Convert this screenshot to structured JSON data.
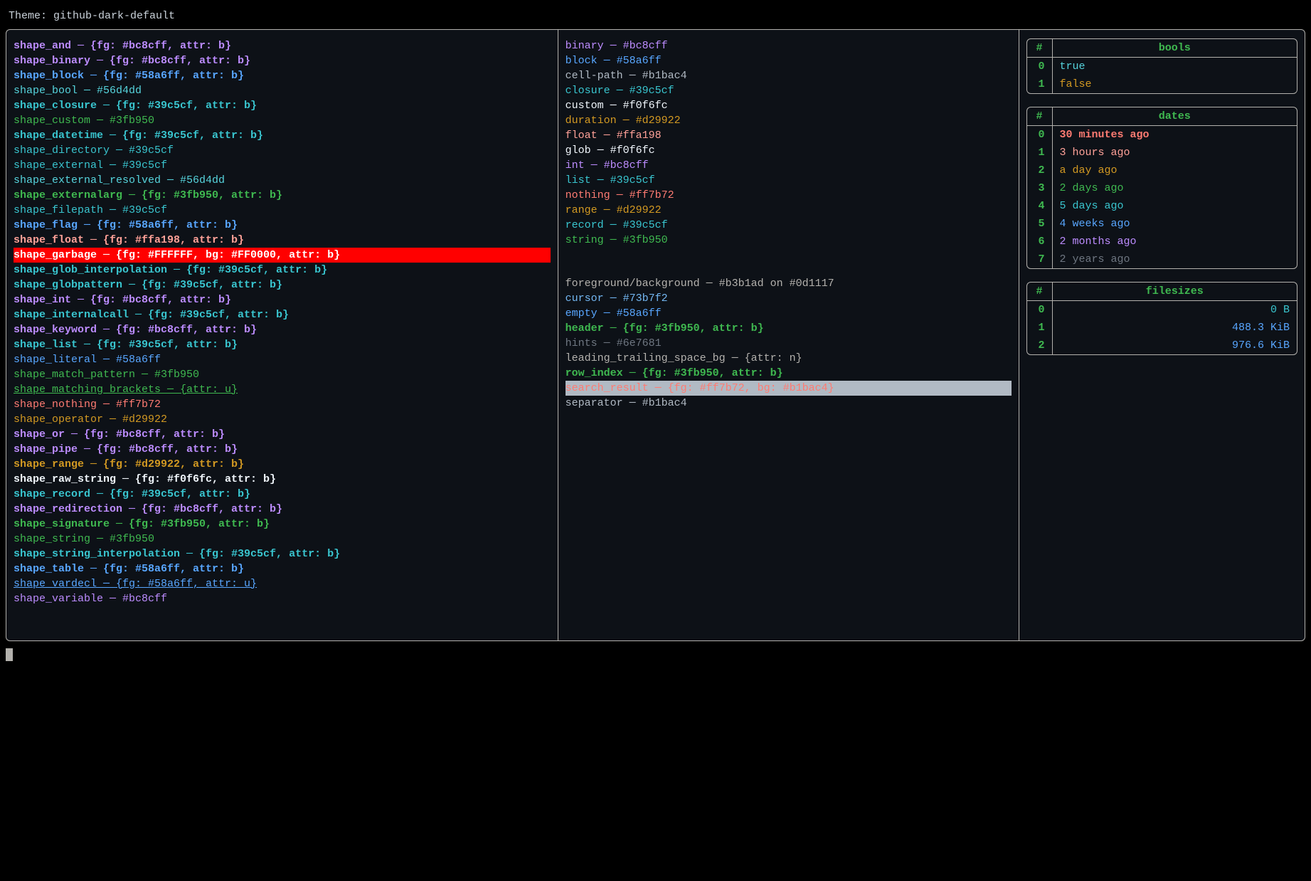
{
  "title_label": "Theme:",
  "title_value": "github-dark-default",
  "shapes": [
    {
      "name": "shape_and",
      "spec": "{fg: #bc8cff, attr: b}",
      "fg": "#bc8cff",
      "bold": true
    },
    {
      "name": "shape_binary",
      "spec": "{fg: #bc8cff, attr: b}",
      "fg": "#bc8cff",
      "bold": true
    },
    {
      "name": "shape_block",
      "spec": "{fg: #58a6ff, attr: b}",
      "fg": "#58a6ff",
      "bold": true
    },
    {
      "name": "shape_bool",
      "spec": "#56d4dd",
      "fg": "#56d4dd"
    },
    {
      "name": "shape_closure",
      "spec": "{fg: #39c5cf, attr: b}",
      "fg": "#39c5cf",
      "bold": true
    },
    {
      "name": "shape_custom",
      "spec": "#3fb950",
      "fg": "#3fb950"
    },
    {
      "name": "shape_datetime",
      "spec": "{fg: #39c5cf, attr: b}",
      "fg": "#39c5cf",
      "bold": true
    },
    {
      "name": "shape_directory",
      "spec": "#39c5cf",
      "fg": "#39c5cf"
    },
    {
      "name": "shape_external",
      "spec": "#39c5cf",
      "fg": "#39c5cf"
    },
    {
      "name": "shape_external_resolved",
      "spec": "#56d4dd",
      "fg": "#56d4dd"
    },
    {
      "name": "shape_externalarg",
      "spec": "{fg: #3fb950, attr: b}",
      "fg": "#3fb950",
      "bold": true
    },
    {
      "name": "shape_filepath",
      "spec": "#39c5cf",
      "fg": "#39c5cf"
    },
    {
      "name": "shape_flag",
      "spec": "{fg: #58a6ff, attr: b}",
      "fg": "#58a6ff",
      "bold": true
    },
    {
      "name": "shape_float",
      "spec": "{fg: #ffa198, attr: b}",
      "fg": "#ffa198",
      "bold": true
    },
    {
      "name": "shape_garbage",
      "spec": "{fg: #FFFFFF, bg: #FF0000, attr: b}",
      "fg": "#FFFFFF",
      "bg": "#FF0000",
      "bold": true
    },
    {
      "name": "shape_glob_interpolation",
      "spec": "{fg: #39c5cf, attr: b}",
      "fg": "#39c5cf",
      "bold": true
    },
    {
      "name": "shape_globpattern",
      "spec": "{fg: #39c5cf, attr: b}",
      "fg": "#39c5cf",
      "bold": true
    },
    {
      "name": "shape_int",
      "spec": "{fg: #bc8cff, attr: b}",
      "fg": "#bc8cff",
      "bold": true
    },
    {
      "name": "shape_internalcall",
      "spec": "{fg: #39c5cf, attr: b}",
      "fg": "#39c5cf",
      "bold": true
    },
    {
      "name": "shape_keyword",
      "spec": "{fg: #bc8cff, attr: b}",
      "fg": "#bc8cff",
      "bold": true
    },
    {
      "name": "shape_list",
      "spec": "{fg: #39c5cf, attr: b}",
      "fg": "#39c5cf",
      "bold": true
    },
    {
      "name": "shape_literal",
      "spec": "#58a6ff",
      "fg": "#58a6ff"
    },
    {
      "name": "shape_match_pattern",
      "spec": "#3fb950",
      "fg": "#3fb950"
    },
    {
      "name": "shape_matching_brackets",
      "spec": "{attr: u}",
      "fg": "#3fb950",
      "underline": true
    },
    {
      "name": "shape_nothing",
      "spec": "#ff7b72",
      "fg": "#ff7b72"
    },
    {
      "name": "shape_operator",
      "spec": "#d29922",
      "fg": "#d29922"
    },
    {
      "name": "shape_or",
      "spec": "{fg: #bc8cff, attr: b}",
      "fg": "#bc8cff",
      "bold": true
    },
    {
      "name": "shape_pipe",
      "spec": "{fg: #bc8cff, attr: b}",
      "fg": "#bc8cff",
      "bold": true
    },
    {
      "name": "shape_range",
      "spec": "{fg: #d29922, attr: b}",
      "fg": "#d29922",
      "bold": true
    },
    {
      "name": "shape_raw_string",
      "spec": "{fg: #f0f6fc, attr: b}",
      "fg": "#f0f6fc",
      "bold": true
    },
    {
      "name": "shape_record",
      "spec": "{fg: #39c5cf, attr: b}",
      "fg": "#39c5cf",
      "bold": true
    },
    {
      "name": "shape_redirection",
      "spec": "{fg: #bc8cff, attr: b}",
      "fg": "#bc8cff",
      "bold": true
    },
    {
      "name": "shape_signature",
      "spec": "{fg: #3fb950, attr: b}",
      "fg": "#3fb950",
      "bold": true
    },
    {
      "name": "shape_string",
      "spec": "#3fb950",
      "fg": "#3fb950"
    },
    {
      "name": "shape_string_interpolation",
      "spec": "{fg: #39c5cf, attr: b}",
      "fg": "#39c5cf",
      "bold": true
    },
    {
      "name": "shape_table",
      "spec": "{fg: #58a6ff, attr: b}",
      "fg": "#58a6ff",
      "bold": true
    },
    {
      "name": "shape_vardecl",
      "spec": "{fg: #58a6ff, attr: u}",
      "fg": "#58a6ff",
      "underline": true
    },
    {
      "name": "shape_variable",
      "spec": "#bc8cff",
      "fg": "#bc8cff"
    }
  ],
  "types": [
    {
      "name": "binary",
      "spec": "#bc8cff",
      "fg": "#bc8cff"
    },
    {
      "name": "block",
      "spec": "#58a6ff",
      "fg": "#58a6ff"
    },
    {
      "name": "cell-path",
      "spec": "#b1bac4",
      "fg": "#b1bac4"
    },
    {
      "name": "closure",
      "spec": "#39c5cf",
      "fg": "#39c5cf"
    },
    {
      "name": "custom",
      "spec": "#f0f6fc",
      "fg": "#f0f6fc"
    },
    {
      "name": "duration",
      "spec": "#d29922",
      "fg": "#d29922"
    },
    {
      "name": "float",
      "spec": "#ffa198",
      "fg": "#ffa198"
    },
    {
      "name": "glob",
      "spec": "#f0f6fc",
      "fg": "#f0f6fc"
    },
    {
      "name": "int",
      "spec": "#bc8cff",
      "fg": "#bc8cff"
    },
    {
      "name": "list",
      "spec": "#39c5cf",
      "fg": "#39c5cf"
    },
    {
      "name": "nothing",
      "spec": "#ff7b72",
      "fg": "#ff7b72"
    },
    {
      "name": "range",
      "spec": "#d29922",
      "fg": "#d29922"
    },
    {
      "name": "record",
      "spec": "#39c5cf",
      "fg": "#39c5cf"
    },
    {
      "name": "string",
      "spec": "#3fb950",
      "fg": "#3fb950"
    }
  ],
  "misc": [
    {
      "name": "foreground/background",
      "spec": "#b3b1ad on #0d1117",
      "fg": "#b3b1ad"
    },
    {
      "name": "cursor",
      "spec": "#73b7f2",
      "fg": "#73b7f2"
    },
    {
      "name": "empty",
      "spec": "#58a6ff",
      "fg": "#58a6ff"
    },
    {
      "name": "header",
      "spec": "{fg: #3fb950, attr: b}",
      "fg": "#3fb950",
      "bold": true
    },
    {
      "name": "hints",
      "spec": "#6e7681",
      "fg": "#6e7681"
    },
    {
      "name": "leading_trailing_space_bg",
      "spec": "{attr: n}",
      "fg": "#b3b1ad"
    },
    {
      "name": "row_index",
      "spec": "{fg: #3fb950, attr: b}",
      "fg": "#3fb950",
      "bold": true
    },
    {
      "name": "search_result",
      "spec": "{fg: #ff7b72, bg: #b1bac4}",
      "fg": "#ff7b72",
      "bg": "#b1bac4"
    },
    {
      "name": "separator",
      "spec": "#b1bac4",
      "fg": "#b1bac4"
    }
  ],
  "tables": {
    "bools": {
      "header": "bools",
      "rows": [
        {
          "i": "0",
          "v": "true",
          "fg": "#56d4dd"
        },
        {
          "i": "1",
          "v": "false",
          "fg": "#d29922"
        }
      ]
    },
    "dates": {
      "header": "dates",
      "rows": [
        {
          "i": "0",
          "v": "30 minutes ago",
          "fg": "#ff7b72",
          "bold": true
        },
        {
          "i": "1",
          "v": "3 hours ago",
          "fg": "#ffa198"
        },
        {
          "i": "2",
          "v": "a day ago",
          "fg": "#d29922"
        },
        {
          "i": "3",
          "v": "2 days ago",
          "fg": "#3fb950"
        },
        {
          "i": "4",
          "v": "5 days ago",
          "fg": "#39c5cf"
        },
        {
          "i": "5",
          "v": "4 weeks ago",
          "fg": "#58a6ff"
        },
        {
          "i": "6",
          "v": "2 months ago",
          "fg": "#bc8cff"
        },
        {
          "i": "7",
          "v": "2 years ago",
          "fg": "#6e7681"
        }
      ]
    },
    "filesizes": {
      "header": "filesizes",
      "rows": [
        {
          "i": "0",
          "v": "0 B",
          "fg": "#39c5cf"
        },
        {
          "i": "1",
          "v": "488.3 KiB",
          "fg": "#58a6ff"
        },
        {
          "i": "2",
          "v": "976.6 KiB",
          "fg": "#58a6ff"
        }
      ]
    }
  },
  "hash": "#"
}
